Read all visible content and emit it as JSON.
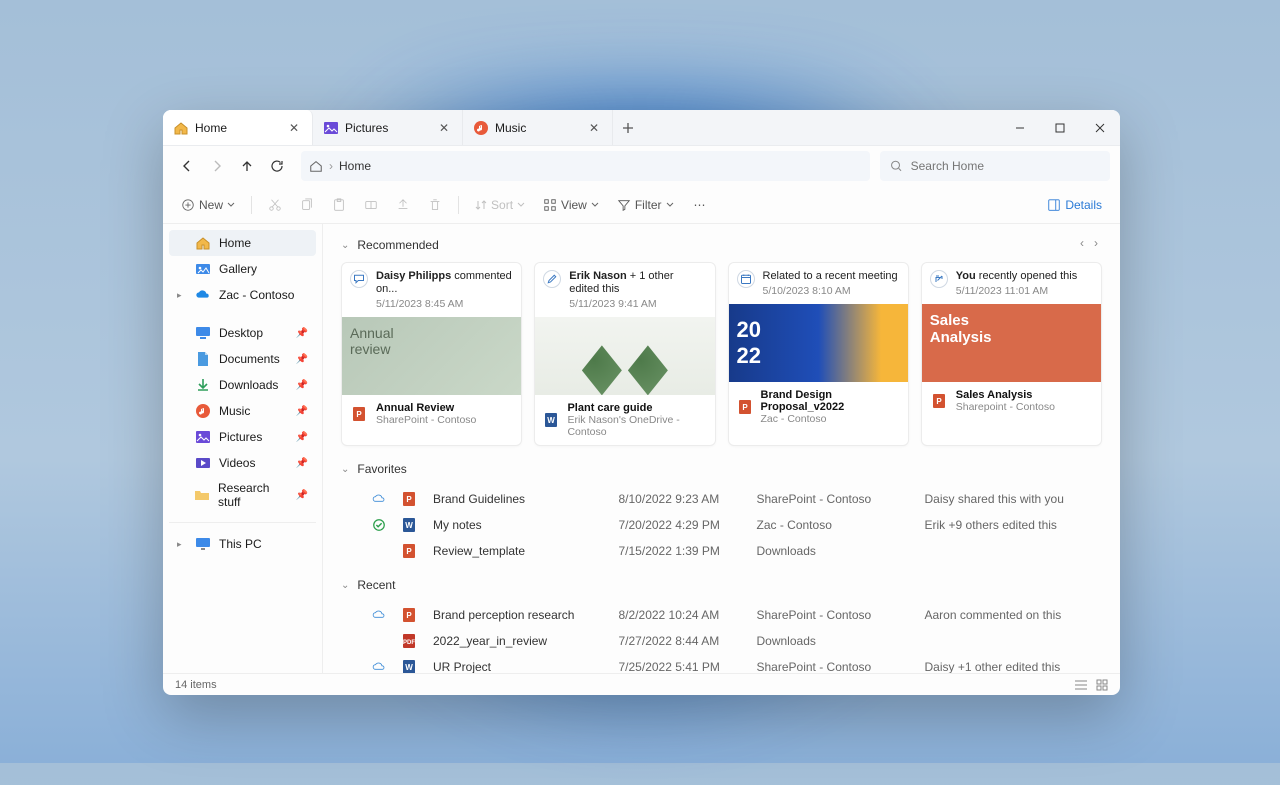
{
  "tabs": [
    {
      "label": "Home",
      "icon": "home"
    },
    {
      "label": "Pictures",
      "icon": "pictures"
    },
    {
      "label": "Music",
      "icon": "music"
    }
  ],
  "address": {
    "location": "Home"
  },
  "search": {
    "placeholder": "Search Home"
  },
  "toolbar": {
    "new": "New",
    "sort": "Sort",
    "view": "View",
    "filter": "Filter",
    "details": "Details"
  },
  "sidebar": {
    "main": [
      {
        "label": "Home",
        "icon": "home",
        "active": true
      },
      {
        "label": "Gallery",
        "icon": "gallery"
      },
      {
        "label": "Zac - Contoso",
        "icon": "onedrive",
        "chevron": true
      }
    ],
    "pinned": [
      {
        "label": "Desktop",
        "icon": "desktop"
      },
      {
        "label": "Documents",
        "icon": "documents"
      },
      {
        "label": "Downloads",
        "icon": "downloads"
      },
      {
        "label": "Music",
        "icon": "music"
      },
      {
        "label": "Pictures",
        "icon": "pictures"
      },
      {
        "label": "Videos",
        "icon": "videos"
      },
      {
        "label": "Research stuff",
        "icon": "folder"
      }
    ],
    "other": [
      {
        "label": "This PC",
        "icon": "pc",
        "chevron": true
      }
    ]
  },
  "sections": {
    "recommended": {
      "title": "Recommended",
      "cards": [
        {
          "badge": "comment",
          "line1a": "Daisy Philipps",
          "line1b": " commented on...",
          "line2": "5/11/2023 8:45 AM",
          "thumb": "thumb1",
          "ftype": "ppt",
          "fname": "Annual Review",
          "floc": "SharePoint - Contoso"
        },
        {
          "badge": "edit",
          "line1a": "Erik Nason",
          "line1b": " + 1 other edited this",
          "line2": "5/11/2023 9:41 AM",
          "thumb": "thumb2",
          "ftype": "word",
          "fname": "Plant care guide",
          "floc": "Erik Nason's OneDrive - Contoso"
        },
        {
          "badge": "calendar",
          "line1a": "",
          "line1b": "Related to a recent meeting",
          "line2": "5/10/2023 8:10 AM",
          "thumb": "thumb3",
          "ftype": "ppt",
          "fname": "Brand Design Proposal_v2022",
          "floc": "Zac - Contoso"
        },
        {
          "badge": "open",
          "line1a": "You",
          "line1b": " recently opened this",
          "line2": "5/11/2023 11:01 AM",
          "thumb": "thumb4",
          "ftype": "ppt",
          "fname": "Sales Analysis",
          "floc": "Sharepoint - Contoso"
        }
      ]
    },
    "favorites": {
      "title": "Favorites",
      "rows": [
        {
          "cloud": "cloud",
          "type": "ppt",
          "name": "Brand Guidelines",
          "date": "8/10/2022 9:23 AM",
          "loc": "SharePoint - Contoso",
          "activity": "Daisy shared this with you"
        },
        {
          "cloud": "sync",
          "type": "word",
          "name": "My notes",
          "date": "7/20/2022 4:29 PM",
          "loc": "Zac - Contoso",
          "activity": "Erik +9 others edited this"
        },
        {
          "cloud": "",
          "type": "ppt",
          "name": "Review_template",
          "date": "7/15/2022 1:39 PM",
          "loc": "Downloads",
          "activity": ""
        }
      ]
    },
    "recent": {
      "title": "Recent",
      "rows": [
        {
          "cloud": "cloud",
          "type": "ppt",
          "name": "Brand perception research",
          "date": "8/2/2022 10:24 AM",
          "loc": "SharePoint - Contoso",
          "activity": "Aaron commented on this"
        },
        {
          "cloud": "",
          "type": "pdf",
          "name": "2022_year_in_review",
          "date": "7/27/2022 8:44 AM",
          "loc": "Downloads",
          "activity": ""
        },
        {
          "cloud": "cloud",
          "type": "word",
          "name": "UR Project",
          "date": "7/25/2022 5:41 PM",
          "loc": "SharePoint - Contoso",
          "activity": "Daisy +1 other edited this"
        }
      ]
    }
  },
  "status": {
    "count": "14 items"
  }
}
